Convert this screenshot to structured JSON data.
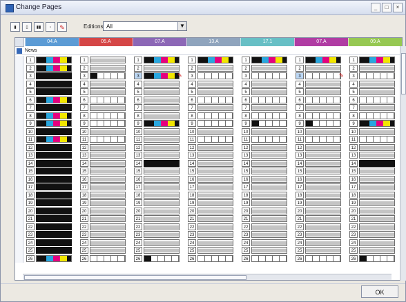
{
  "window": {
    "title": "Change Pages"
  },
  "toolbar": {
    "editions_label": "Editions",
    "editions_value": "All"
  },
  "section_label": "News",
  "columns": [
    {
      "label": "04.A",
      "color": "#5b9bd5"
    },
    {
      "label": "05.A",
      "color": "#d54646"
    },
    {
      "label": "07.A",
      "color": "#8c67b6"
    },
    {
      "label": "13.A",
      "color": "#8fa4bd"
    },
    {
      "label": "17.1",
      "color": "#67bfc5"
    },
    {
      "label": "07.A",
      "color": "#b03ca3"
    },
    {
      "label": "09.A",
      "color": "#96c852"
    }
  ],
  "row_numbers": [
    "1",
    "2",
    "3",
    "4",
    "5",
    "6",
    "7",
    "8",
    "9",
    "10",
    "11",
    "12",
    "13",
    "14",
    "15",
    "16",
    "17",
    "18",
    "19",
    "20",
    "21",
    "22",
    "23",
    "24",
    "25",
    "26"
  ],
  "cell_types": [
    [
      "cmyk",
      "gray",
      "cmyk",
      "cmyk",
      "cmyk",
      "cmyk",
      "cmyk"
    ],
    [
      "cmyk",
      "gray",
      "gray",
      "gray",
      "gray",
      "gray",
      "gray"
    ],
    [
      "black",
      "halfdots",
      "cmyk",
      "dots",
      "dots",
      "dots",
      "dots"
    ],
    [
      "black",
      "gray",
      "gray",
      "gray",
      "gray",
      "gray",
      "gray"
    ],
    [
      "black",
      "gray",
      "gray",
      "gray",
      "gray",
      "gray",
      "gray"
    ],
    [
      "cmyk",
      "dots",
      "gray",
      "dots",
      "dots",
      "dots",
      "dots"
    ],
    [
      "black",
      "gray",
      "gray",
      "gray",
      "gray",
      "gray",
      "gray"
    ],
    [
      "cmyk",
      "dots",
      "gray",
      "dots",
      "dots",
      "dots",
      "dots"
    ],
    [
      "cmyk",
      "dots",
      "cmyk",
      "dots",
      "halfdots",
      "halfdots",
      "cmyk"
    ],
    [
      "black",
      "gray",
      "gray",
      "gray",
      "gray",
      "gray",
      "gray"
    ],
    [
      "cmyk",
      "dots",
      "gray",
      "dots",
      "dots",
      "dots",
      "dots"
    ],
    [
      "black",
      "gray",
      "gray",
      "gray",
      "gray",
      "gray",
      "gray"
    ],
    [
      "black",
      "gray",
      "gray",
      "gray",
      "gray",
      "gray",
      "gray"
    ],
    [
      "black",
      "gray",
      "black",
      "gray",
      "gray",
      "gray",
      "black"
    ],
    [
      "black",
      "gray",
      "gray",
      "gray",
      "gray",
      "gray",
      "gray"
    ],
    [
      "black",
      "gray",
      "gray",
      "gray",
      "gray",
      "gray",
      "gray"
    ],
    [
      "black",
      "gray",
      "gray",
      "gray",
      "gray",
      "gray",
      "gray"
    ],
    [
      "black",
      "gray",
      "gray",
      "gray",
      "gray",
      "gray",
      "gray"
    ],
    [
      "black",
      "gray",
      "gray",
      "gray",
      "gray",
      "gray",
      "gray"
    ],
    [
      "black",
      "gray",
      "gray",
      "gray",
      "gray",
      "gray",
      "gray"
    ],
    [
      "black",
      "gray",
      "gray",
      "gray",
      "gray",
      "gray",
      "gray"
    ],
    [
      "black",
      "gray",
      "gray",
      "gray",
      "gray",
      "gray",
      "gray"
    ],
    [
      "black",
      "gray",
      "gray",
      "gray",
      "gray",
      "gray",
      "gray"
    ],
    [
      "black",
      "gray",
      "gray",
      "gray",
      "gray",
      "gray",
      "gray"
    ],
    [
      "black",
      "gray",
      "gray",
      "gray",
      "gray",
      "gray",
      "gray"
    ],
    [
      "cmyk",
      "dots",
      "halfdots",
      "dots",
      "dots",
      "dots",
      "halfdots"
    ]
  ],
  "selected_cell": {
    "row": "3",
    "column": "07.A"
  },
  "buttons": {
    "ok": "OK"
  },
  "colors": {
    "selection": "#bcd7f4",
    "cyan": "#29a7df",
    "magenta": "#e6007e",
    "yellow": "#f2e600",
    "black": "#111111"
  }
}
